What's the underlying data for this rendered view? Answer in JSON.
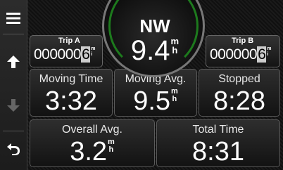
{
  "nav": {
    "menu_icon": "menu-icon",
    "up_icon": "up-arrow-icon",
    "down_icon": "down-arrow-icon",
    "back_icon": "back-icon"
  },
  "compass": {
    "heading": "NW",
    "speed": "9.4",
    "speed_unit_top": "m",
    "speed_unit_bottom": "h"
  },
  "trip_a": {
    "label": "Trip A",
    "odometer": "000000",
    "last_digit": "6",
    "unit_top": "m",
    "unit_bottom": "i"
  },
  "trip_b": {
    "label": "Trip B",
    "odometer": "000000",
    "last_digit": "6",
    "unit_top": "m",
    "unit_bottom": "i"
  },
  "tiles": [
    {
      "label": "Moving Time",
      "value": "3:32"
    },
    {
      "label": "Moving Avg.",
      "value": "9.5",
      "unit_top": "m",
      "unit_bottom": "h"
    },
    {
      "label": "Stopped",
      "value": "8:28"
    },
    {
      "label": "Overall Avg.",
      "value": "3.2",
      "unit_top": "m",
      "unit_bottom": "h"
    },
    {
      "label": "Total Time",
      "value": "8:31"
    }
  ],
  "colors": {
    "accent_green": "#1fa51f",
    "tile_border": "#5a5a5a"
  }
}
